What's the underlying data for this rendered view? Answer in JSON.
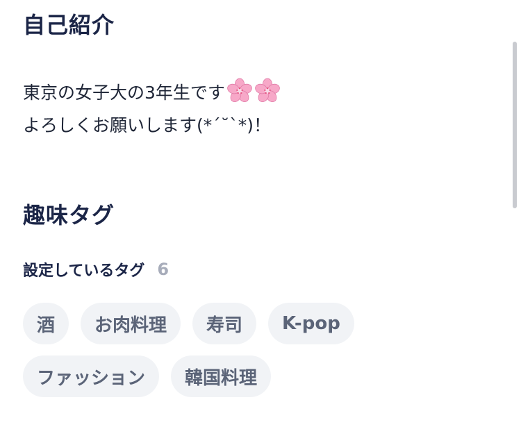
{
  "intro": {
    "title": "自己紹介",
    "bio_line1": "東京の女子大の3年生です",
    "bio_emoji": [
      "cherry-blossom-icon",
      "cherry-blossom-icon"
    ],
    "bio_line2": "よろしくお願いします(*´˘`*)！"
  },
  "hobby": {
    "title": "趣味タグ",
    "subheader": "設定しているタグ",
    "count": "6",
    "tags": [
      "酒",
      "お肉料理",
      "寿司",
      "K-pop",
      "ファッション",
      "韓国料理"
    ]
  },
  "colors": {
    "heading": "#1b2547",
    "tag_bg": "#f1f3f6",
    "tag_text": "#5b6478",
    "count": "#a7acba",
    "flower": "#f7a8c8"
  }
}
